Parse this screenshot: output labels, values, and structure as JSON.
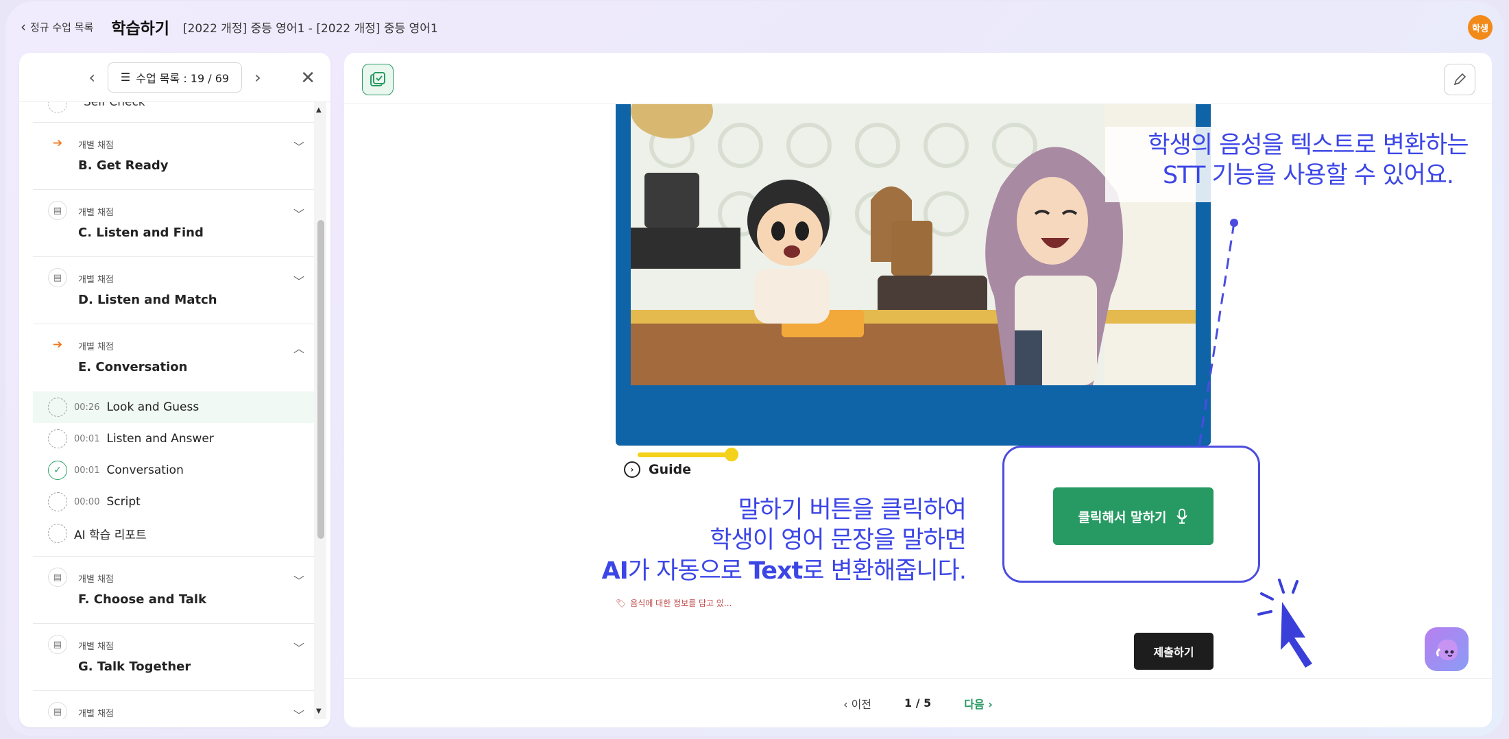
{
  "header": {
    "back_label": "정규 수업 목록",
    "title": "학습하기",
    "course": "[2022 개정] 중등 영어1 - [2022 개정] 중등 영어1",
    "user_badge": "학생"
  },
  "sidebar": {
    "lesson_list_label": "수업 목록 : 19 / 69",
    "partial_top_title": "Self Check",
    "sections": [
      {
        "type": "개별 채점",
        "title": "B. Get Ready",
        "icon": "arrow-progress-icon",
        "state": "collapsed"
      },
      {
        "type": "개별 채점",
        "title": "C. Listen and Find",
        "icon": "document-icon",
        "state": "collapsed"
      },
      {
        "type": "개별 채점",
        "title": "D. Listen and Match",
        "icon": "document-icon",
        "state": "collapsed"
      },
      {
        "type": "개별 채점",
        "title": "E. Conversation",
        "icon": "arrow-progress-icon",
        "state": "expanded"
      },
      {
        "type": "개별 채점",
        "title": "F. Choose and Talk",
        "icon": "document-icon",
        "state": "collapsed"
      },
      {
        "type": "개별 채점",
        "title": "G. Talk Together",
        "icon": "document-icon",
        "state": "collapsed"
      },
      {
        "type": "개별 채점",
        "title": "",
        "icon": "document-icon",
        "state": "collapsed"
      }
    ],
    "sub_items": [
      {
        "time": "00:26",
        "name": "Look and Guess",
        "status": "in-progress",
        "active": true
      },
      {
        "time": "00:01",
        "name": "Listen and Answer",
        "status": "in-progress",
        "active": false
      },
      {
        "time": "00:01",
        "name": "Conversation",
        "status": "done",
        "active": false
      },
      {
        "time": "00:00",
        "name": "Script",
        "status": "in-progress",
        "active": false
      },
      {
        "time": "",
        "name": "AI 학습 리포트",
        "status": "in-progress",
        "active": false
      }
    ]
  },
  "main": {
    "video": {
      "progress": 0.17
    },
    "guide_label": "Guide",
    "speak_button_label": "클릭해서 말하기",
    "tag_text": "음식에 대한 정보를 담고 있...",
    "submit_label": "제출하기",
    "pager": {
      "prev": "이전",
      "page": "1 / 5",
      "next": "다음"
    }
  },
  "annotations": {
    "stt_line1": "학생의 음성을 텍스트로 변환하는",
    "stt_line2": "STT 기능을 사용할 수 있어요.",
    "speak_line1": "말하기 버튼을 클릭하여",
    "speak_line2": "학생이 영어 문장을 말하면",
    "speak_line3_ai": "AI",
    "speak_line3_mid": "가 자동으로 ",
    "speak_line3_text": "Text",
    "speak_line3_end": "로 변환해줍니다."
  },
  "colors": {
    "accent_green": "#279a63",
    "annotation_blue": "#3c46e6",
    "video_frame_blue": "#0f64a8",
    "badge_orange": "#f28a1a"
  }
}
